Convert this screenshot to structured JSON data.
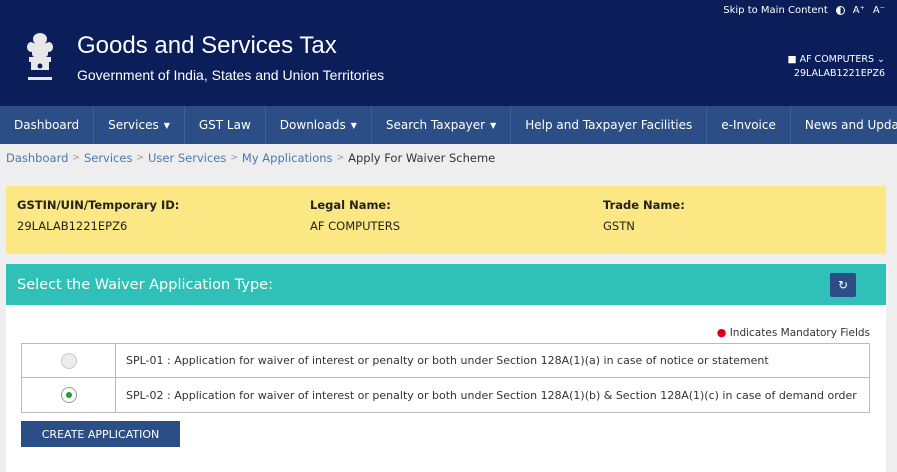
{
  "topbar": {
    "skip_label": "Skip to Main Content",
    "font_increase": "A⁺",
    "font_decrease": "A⁻"
  },
  "header": {
    "title": "Goods and Services Tax",
    "subtitle": "Government of India, States and Union Territories",
    "user_name": "AF COMPUTERS",
    "user_gstin": "29LALAB1221EPZ6"
  },
  "nav": {
    "items": [
      {
        "label": "Dashboard",
        "dropdown": false
      },
      {
        "label": "Services",
        "dropdown": true
      },
      {
        "label": "GST Law",
        "dropdown": false
      },
      {
        "label": "Downloads",
        "dropdown": true
      },
      {
        "label": "Search Taxpayer",
        "dropdown": true
      },
      {
        "label": "Help and Taxpayer Facilities",
        "dropdown": false
      },
      {
        "label": "e-Invoice",
        "dropdown": false
      },
      {
        "label": "News and Updates",
        "dropdown": false
      }
    ]
  },
  "breadcrumb": {
    "items": [
      "Dashboard",
      "Services",
      "User Services",
      "My Applications"
    ],
    "current": "Apply For Waiver Scheme"
  },
  "taxpayer": {
    "gstin_label": "GSTIN/UIN/Temporary ID:",
    "gstin_value": "29LALAB1221EPZ6",
    "legal_label": "Legal Name:",
    "legal_value": "AF COMPUTERS",
    "trade_label": "Trade Name:",
    "trade_value": "GSTN"
  },
  "waiver": {
    "heading": "Select the Waiver Application Type:",
    "mandatory_note": "Indicates Mandatory Fields",
    "options": [
      {
        "text": "SPL-01 : Application for waiver of interest or penalty or both under Section 128A(1)(a) in case of notice or statement",
        "selected": false
      },
      {
        "text": "SPL-02 : Application for waiver of interest or penalty or both under Section 128A(1)(b) & Section 128A(1)(c) in case of demand order",
        "selected": true
      }
    ],
    "create_button": "CREATE APPLICATION"
  },
  "colors": {
    "header_bg": "#0b1e59",
    "nav_bg": "#2c4e86",
    "info_bg": "#fbe783",
    "section_head_bg": "#2fc1b7",
    "radio_selected": "#1aa32a"
  },
  "icons": {
    "emblem": "ashoka-emblem-icon",
    "user": "user-icon",
    "refresh": "refresh-icon",
    "contrast": "contrast-icon"
  }
}
